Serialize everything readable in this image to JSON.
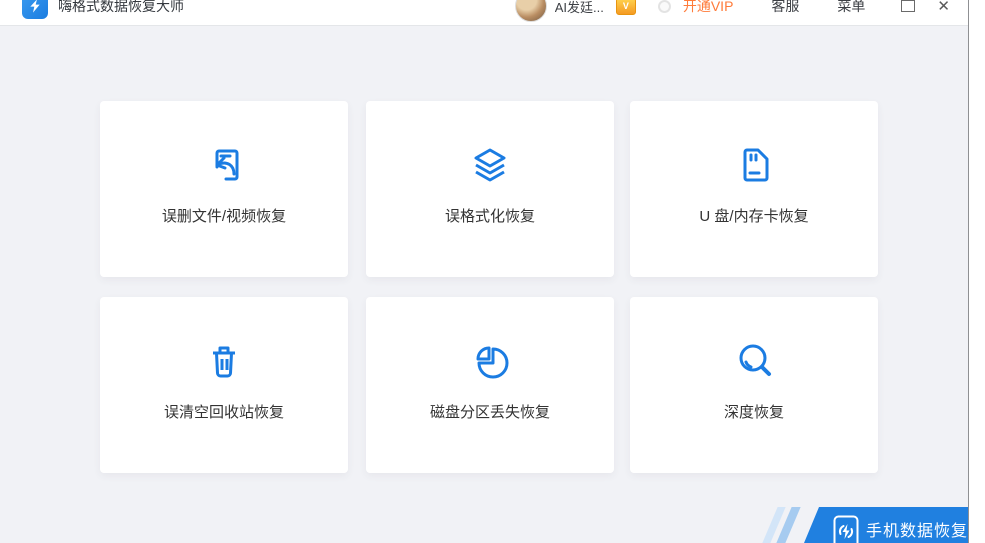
{
  "app": {
    "title": "嗨格式数据恢复大师"
  },
  "titlebar": {
    "username": "AI发廷...",
    "upgrade_vip_label": "开通VIP",
    "customer_service_label": "客服",
    "menu_label": "菜单",
    "close_glyph": "✕"
  },
  "cards": [
    {
      "label": "误删文件/视频恢复",
      "icon": "file-undo-icon"
    },
    {
      "label": "误格式化恢复",
      "icon": "layers-icon"
    },
    {
      "label": "U 盘/内存卡恢复",
      "icon": "sd-card-icon"
    },
    {
      "label": "误清空回收站恢复",
      "icon": "trash-icon"
    },
    {
      "label": "磁盘分区丢失恢复",
      "icon": "pie-disk-icon"
    },
    {
      "label": "深度恢复",
      "icon": "magnifier-icon"
    }
  ],
  "footer": {
    "phone_recovery_label": "手机数据恢复"
  },
  "colors": {
    "accent_blue": "#1b7ce2",
    "banner_blue": "#2080e0",
    "vip_orange": "#ff7b3a",
    "background": "#f1f2f6"
  }
}
